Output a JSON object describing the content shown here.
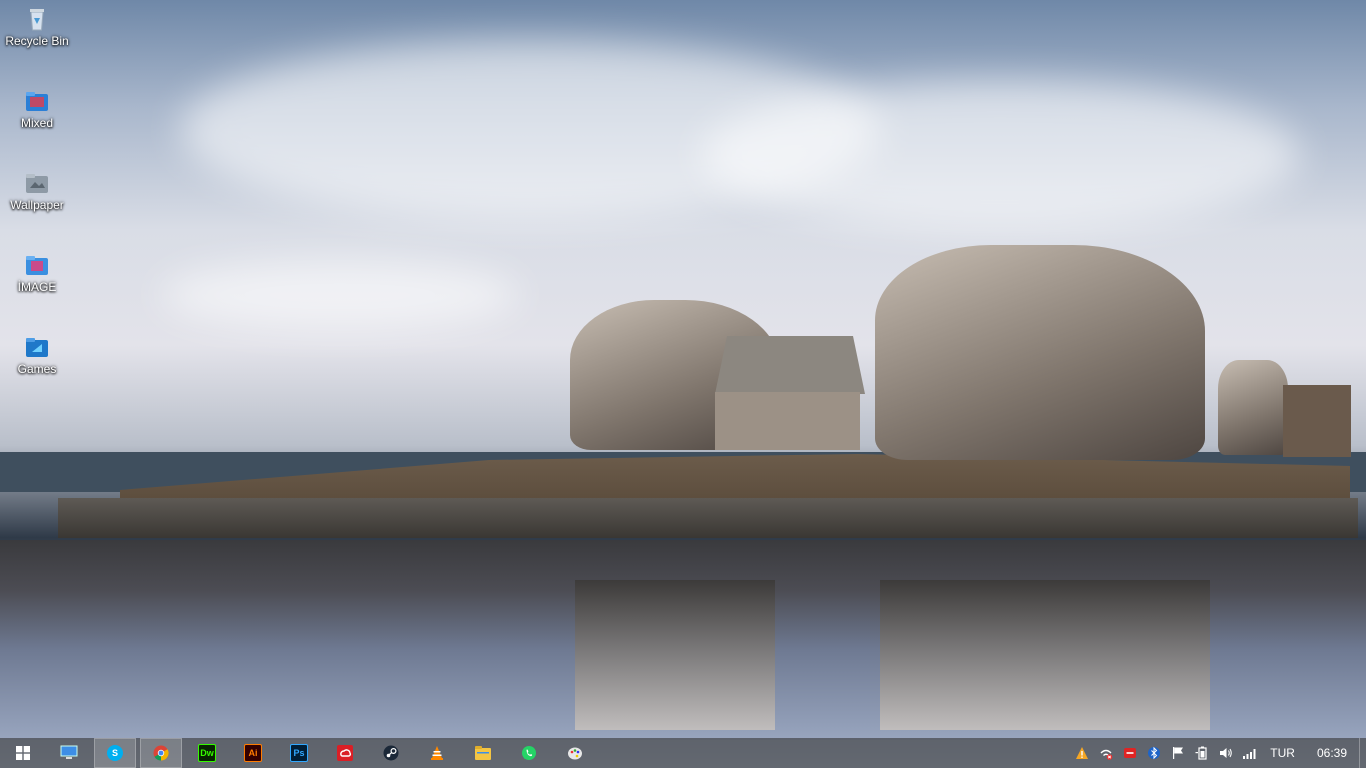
{
  "desktop": {
    "icons": [
      {
        "label": "Recycle Bin",
        "icon": "recycle-bin-icon"
      },
      {
        "label": "Mixed",
        "icon": "folder-icon"
      },
      {
        "label": "Wallpaper",
        "icon": "folder-icon"
      },
      {
        "label": "İMAGE",
        "icon": "folder-icon"
      },
      {
        "label": "Games",
        "icon": "folder-icon"
      }
    ]
  },
  "taskbar": {
    "pinned": [
      {
        "name": "start-button",
        "icon": "windows-logo-icon"
      },
      {
        "name": "this-pc",
        "icon": "computer-icon"
      },
      {
        "name": "skype",
        "icon": "skype-icon",
        "open": true,
        "color": "#00aff0"
      },
      {
        "name": "chrome",
        "icon": "chrome-icon",
        "open": true
      },
      {
        "name": "dreamweaver",
        "icon": "dreamweaver-icon",
        "text": "Dw",
        "color": "#35fa00"
      },
      {
        "name": "illustrator",
        "icon": "illustrator-icon",
        "text": "Ai",
        "color": "#ff7c00"
      },
      {
        "name": "photoshop",
        "icon": "photoshop-icon",
        "text": "Ps",
        "color": "#31a8ff"
      },
      {
        "name": "creative-cloud",
        "icon": "creative-cloud-icon",
        "color": "#da1f26"
      },
      {
        "name": "steam",
        "icon": "steam-icon"
      },
      {
        "name": "vlc",
        "icon": "vlc-icon",
        "color": "#ff8800"
      },
      {
        "name": "file-explorer",
        "icon": "folder-icon",
        "color": "#f4c542"
      },
      {
        "name": "whatsapp",
        "icon": "whatsapp-icon",
        "color": "#25d366"
      },
      {
        "name": "paint",
        "icon": "paint-icon"
      }
    ],
    "tray": {
      "language": "TUR",
      "clock": "06:39"
    }
  }
}
